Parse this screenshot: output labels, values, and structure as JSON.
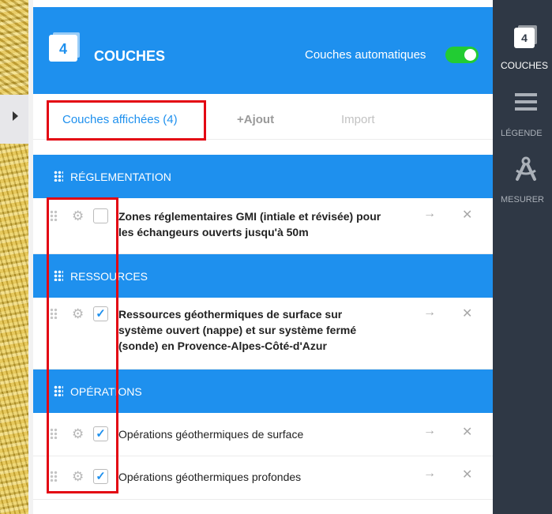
{
  "header": {
    "badge_count": "4",
    "title": "COUCHES",
    "auto_label": "Couches automatiques",
    "auto_enabled": true
  },
  "tabs": [
    {
      "label": "Couches affichées (4)",
      "active": true
    },
    {
      "label": "+Ajout",
      "active": false
    },
    {
      "label": "Import",
      "active": false
    }
  ],
  "sections": [
    {
      "title": "RÉGLEMENTATION",
      "layers": [
        {
          "label_line1": "Zones réglementaires GMI (intiale et révisée) pour",
          "label_line2": "les échangeurs ouverts jusqu'à 50m",
          "label_line3": "",
          "checked": false
        }
      ]
    },
    {
      "title": "RESSOURCES",
      "layers": [
        {
          "label_line1": "Ressources géothermiques de surface sur",
          "label_line2": "système ouvert (nappe) et sur système fermé",
          "label_line3": "(sonde) en Provence-Alpes-Côté-d'Azur",
          "checked": true
        }
      ]
    },
    {
      "title": "OPÉRATIONS",
      "layers": [
        {
          "label_line1": "Opérations géothermiques de surface",
          "checked": true
        },
        {
          "label_line1": "Opérations géothermiques profondes",
          "checked": true
        }
      ]
    }
  ],
  "row_icons": {
    "arrow": "→",
    "close": "✕",
    "gear": "⚙",
    "check": "✓"
  },
  "rightbar": {
    "badge_count": "4",
    "items": [
      {
        "label": "COUCHES",
        "icon": "layers-icon"
      },
      {
        "label": "LÉGENDE",
        "icon": "list-icon"
      },
      {
        "label": "MESURER",
        "icon": "compass-icon"
      }
    ]
  },
  "colors": {
    "primary": "#1e90ee",
    "toggle_on": "#22cc33",
    "sidebar": "#2f3845",
    "highlight": "#e30613"
  }
}
